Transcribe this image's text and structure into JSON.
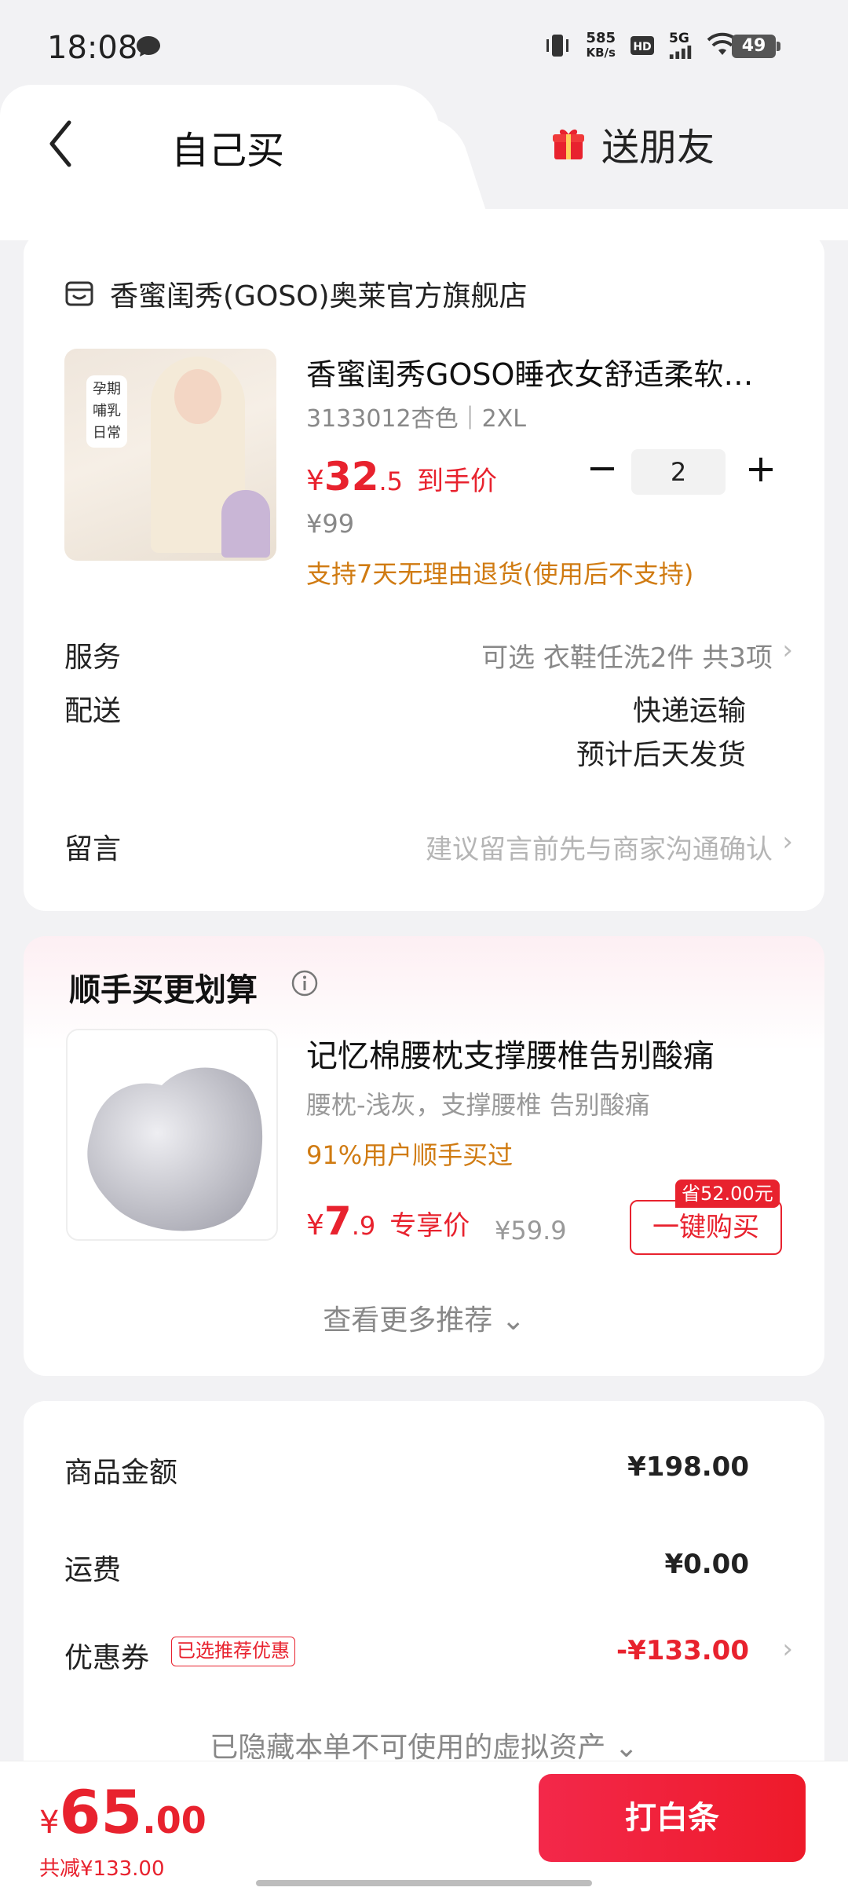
{
  "status_bar": {
    "time": "18:08",
    "speed_value": "585",
    "speed_unit": "KB/s",
    "network": "5G",
    "battery": "49"
  },
  "header": {
    "tab_self": "自己买",
    "tab_friend": "送朋友"
  },
  "order": {
    "store_name": "香蜜闺秀(GOSO)奥莱官方旗舰店",
    "product": {
      "title": "香蜜闺秀GOSO睡衣女舒适柔软…",
      "spec": "3133012杏色｜2XL",
      "price_yen": "¥",
      "price_int": "32",
      "price_dec": ".5",
      "price_label": "到手价",
      "orig_price": "¥99",
      "qty_minus": "−",
      "quantity": "2",
      "qty_plus": "+",
      "return_policy": "支持7天无理由退货(使用后不支持)",
      "image_tags": [
        "孕期",
        "哺乳",
        "日常"
      ]
    },
    "service_label": "服务",
    "service_value": "可选 衣鞋任洗2件 共3项",
    "shipping_label": "配送",
    "shipping_method": "快递运输",
    "shipping_eta": "预计后天发货",
    "message_label": "留言",
    "message_placeholder": "建议留言前先与商家沟通确认",
    "chevron": "›"
  },
  "recommend": {
    "title": "顺手买更划算",
    "item_title": "记忆棉腰枕支撑腰椎告别酸痛",
    "item_sub": "腰枕-浅灰，支撑腰椎 告别酸痛",
    "item_rate": "91%用户顺手买过",
    "price_yen": "¥",
    "price_int": "7",
    "price_dec": ".9",
    "price_label": "专享价",
    "orig_price": "¥59.9",
    "save_tag": "省52.00元",
    "buy_label": "一键购买",
    "more": "查看更多推荐 ⌄"
  },
  "amounts": {
    "goods_label": "商品金额",
    "goods_value": "¥198.00",
    "freight_label": "运费",
    "freight_value": "¥0.00",
    "coupon_label": "优惠券",
    "coupon_badge": "已选推荐优惠",
    "coupon_value": "-¥133.00",
    "hidden_assets": "已隐藏本单不可使用的虚拟资产 ⌄"
  },
  "bottom": {
    "total_yen": "¥",
    "total_int": "65",
    "total_dec": ".00",
    "total_discount": "共减¥133.00",
    "pay_label": "打白条"
  },
  "colors": {
    "accent": "#e8222e",
    "orange": "#d07b12",
    "muted": "#888888"
  }
}
